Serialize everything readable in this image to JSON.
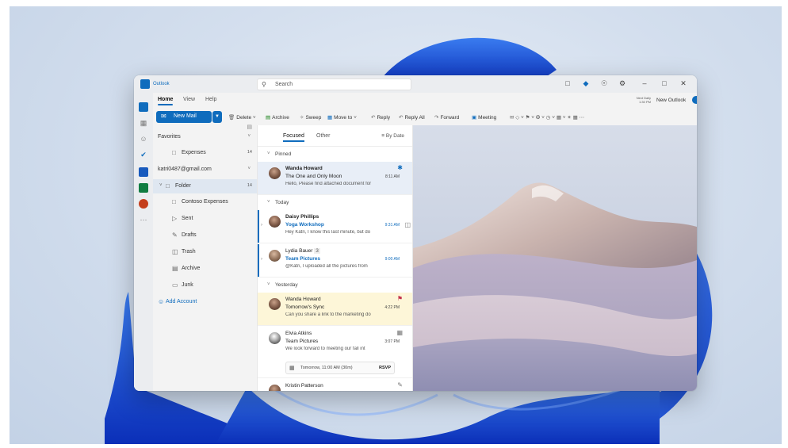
{
  "colors": {
    "accent": "#0f6cbd",
    "flag": "#c4314b",
    "highlight": "#fdf6d8"
  },
  "titlebar": {
    "app_name": "Outlook",
    "search_placeholder": "Search",
    "buttons": [
      "whiteboard-icon",
      "premium-icon",
      "bell-icon",
      "gear-icon",
      "minimize-icon",
      "maximize-icon",
      "close-icon"
    ]
  },
  "tabs": [
    "Home",
    "View",
    "Help"
  ],
  "sync_info": {
    "line1": "Next Daily",
    "line2": "1:30 PM"
  },
  "new_outlook": {
    "label": "New Outlook",
    "enabled": true
  },
  "ribbon": {
    "new_mail": "New Mail",
    "delete": "Delete",
    "archive": "Archive",
    "sweep": "Sweep",
    "move_to": "Move to",
    "reply": "Reply",
    "reply_all": "Reply All",
    "forward": "Forward",
    "meeting": "Meeting"
  },
  "folders": {
    "favorites": "Favorites",
    "expenses": {
      "label": "Expenses",
      "count": "14"
    },
    "account": "katri0487@gmail.com",
    "folder": {
      "label": "Folder",
      "count": "14"
    },
    "items": [
      "Contoso Expenses",
      "Sent",
      "Drafts",
      "Trash",
      "Archive",
      "Junk"
    ],
    "add_account": "Add Account"
  },
  "list": {
    "tab_focused": "Focused",
    "tab_other": "Other",
    "sort": "By Date",
    "group_pinned": "Pinned",
    "group_today": "Today",
    "group_yesterday": "Yesterday",
    "messages": [
      {
        "from": "Wanda Howard",
        "subject": "The One and Only Moon",
        "preview": "Hello, Please find attached document for",
        "time": "8:11 AM"
      },
      {
        "from": "Daisy Phillips",
        "subject": "Yoga Workshop",
        "preview": "Hey Katri, I know this last minute, but do",
        "time": "9:31 AM"
      },
      {
        "from": "Lydia Bauer",
        "count": "3",
        "subject": "Team Pictures",
        "preview": "@Katri, I uploaded all the pictures from",
        "time": "9:00 AM"
      },
      {
        "from": "Wanda Howard",
        "subject": "Tomorrow's Sync",
        "preview": "Can you share a link to the marketing do",
        "time": "4:22 PM"
      },
      {
        "from": "Elvia Atkins",
        "subject": "Team Pictures",
        "preview": "We look forward to meeting our fall int",
        "time": "3:07 PM",
        "event": "Tomorrow, 11:00 AM (30m)",
        "rsvp": "RSVP"
      },
      {
        "from": "Kristin Patterson"
      }
    ]
  }
}
